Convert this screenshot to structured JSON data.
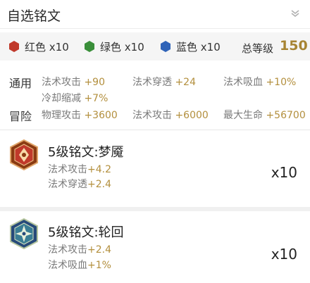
{
  "header": {
    "title": "自选铭文",
    "chevron_icon": "chevron-down-icon"
  },
  "colors": {
    "items": [
      {
        "label": "红色 x10",
        "icon": "hexagon-icon",
        "color": "#c0392b"
      },
      {
        "label": "绿色 x10",
        "icon": "hexagon-icon",
        "color": "#3a8f3a"
      },
      {
        "label": "蓝色 x10",
        "icon": "hexagon-icon",
        "color": "#2f63b8"
      }
    ],
    "level_label": "总等级",
    "level_value": "150"
  },
  "stats": {
    "general": {
      "label": "通用",
      "items": [
        {
          "name": "法术攻击",
          "value": "+90"
        },
        {
          "name": "法术穿透",
          "value": "+24"
        },
        {
          "name": "法术吸血",
          "value": "+10%"
        },
        {
          "name": "冷却缩减",
          "value": "+7%"
        }
      ]
    },
    "adventure": {
      "label": "冒险",
      "items": [
        {
          "name": "物理攻击",
          "value": "+3600"
        },
        {
          "name": "法术攻击",
          "value": "+6000"
        },
        {
          "name": "最大生命",
          "value": "+56700"
        }
      ]
    }
  },
  "runes": [
    {
      "title": "5级铭文:梦魇",
      "stats": [
        {
          "name": "法术攻击",
          "value": "+4.2"
        },
        {
          "name": "法术穿透",
          "value": "+2.4"
        }
      ],
      "qty": "x10",
      "icon": "nightmare-rune-icon",
      "color": "#c0392b"
    },
    {
      "title": "5级铭文:轮回",
      "stats": [
        {
          "name": "法术攻击",
          "value": "+2.4"
        },
        {
          "name": "法术吸血",
          "value": "+1%"
        }
      ],
      "qty": "x10",
      "icon": "reincarnation-rune-icon",
      "color": "#2f63b8"
    }
  ]
}
